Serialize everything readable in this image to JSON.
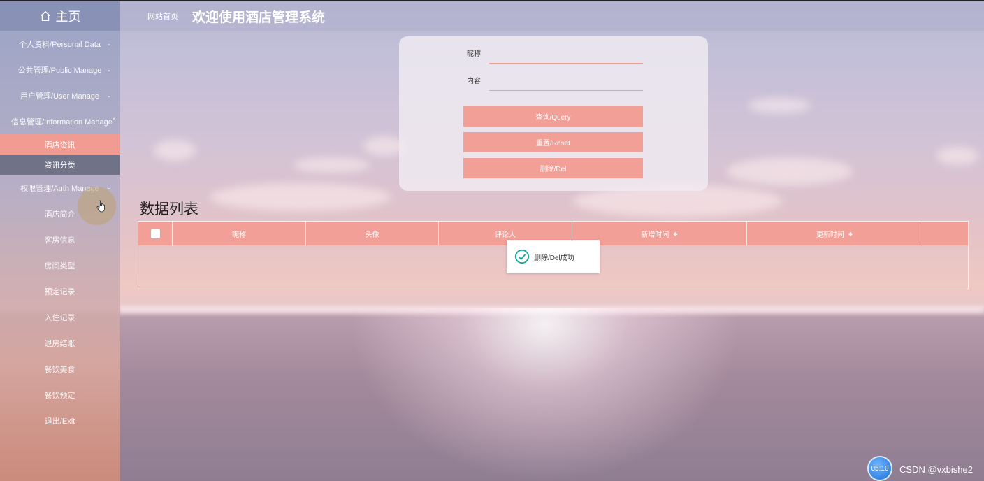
{
  "sidebar": {
    "home_label": "主页",
    "items": [
      {
        "label": "个人资料/Personal Data",
        "chevron": "chevron-down"
      },
      {
        "label": "公共管理/Public Manage",
        "chevron": "chevron-down"
      },
      {
        "label": "用户管理/User Manage",
        "chevron": "chevron-down"
      },
      {
        "label": "信息管理/Information Manage",
        "chevron": "chevron-up"
      }
    ],
    "sub_items": [
      {
        "label": "酒店资讯",
        "active": true
      },
      {
        "label": "资讯分类",
        "active": false
      }
    ],
    "auth_item": {
      "label": "权限管理/Auth Manage",
      "chevron": "chevron-down"
    },
    "links": [
      "酒店简介",
      "客房信息",
      "房间类型",
      "预定记录",
      "入住记录",
      "退房结账",
      "餐饮美食",
      "餐饮预定",
      "退出/Exit"
    ]
  },
  "header": {
    "breadcrumb": "网站首页",
    "title": "欢迎使用酒店管理系统"
  },
  "search": {
    "nickname_label": "昵称",
    "nickname_value": "",
    "content_label": "内容",
    "content_value": "",
    "query_button": "查询/Query",
    "reset_button": "重置/Reset",
    "delete_button": "删除/Del"
  },
  "list": {
    "title": "数据列表",
    "columns": [
      {
        "label": "昵称",
        "sortable": false
      },
      {
        "label": "头像",
        "sortable": false
      },
      {
        "label": "评论人",
        "sortable": false
      },
      {
        "label": "新增时间",
        "sortable": true
      },
      {
        "label": "更新时间",
        "sortable": true
      },
      {
        "label": "",
        "sortable": false
      }
    ],
    "rows": []
  },
  "toast": {
    "message": "删除/Del成功",
    "icon": "check-circle-icon"
  },
  "footer": {
    "timer": "05:10",
    "watermark": "CSDN @vxbishe2"
  },
  "colors": {
    "accent": "#f2a097",
    "active_menu": "#f09c92",
    "toast_check": "#19a6a0"
  }
}
